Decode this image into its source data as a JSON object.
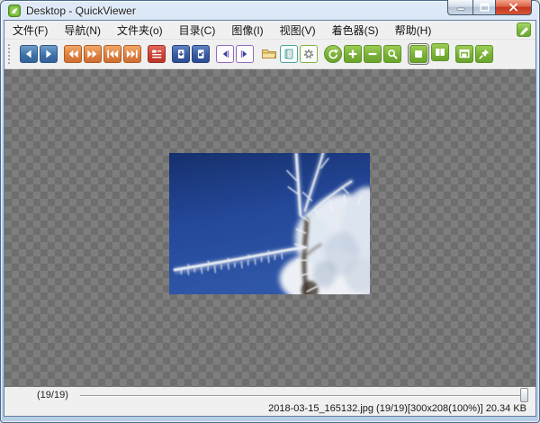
{
  "window": {
    "title": "Desktop - QuickViewer",
    "controls": [
      "minimize-icon",
      "maximize-icon",
      "close-icon"
    ]
  },
  "menu": {
    "items": [
      "文件(F)",
      "导航(N)",
      "文件夹(o)",
      "目录(C)",
      "图像(I)",
      "视图(V)",
      "着色器(S)",
      "帮助(H)"
    ],
    "edit_button_icon": "pencil-icon"
  },
  "toolbar": {
    "buttons": [
      "prev-image",
      "next-image",
      "fast-backward",
      "fast-forward",
      "first-image",
      "last-image",
      "file-list",
      "next-volume",
      "prev-volume",
      "prev-folder",
      "next-folder",
      "open-folder",
      "catalog",
      "settings",
      "reload",
      "zoom-in",
      "zoom-out",
      "zoom-search",
      "fit-window",
      "spread-view",
      "fullscreen",
      "stay-on-top"
    ],
    "selected_button": "fit-window"
  },
  "statusbar": {
    "page_indicator": "(19/19)",
    "status_text": "2018-03-15_165132.jpg (19/19)[300x208(100%)] 20.34 KB"
  },
  "colors": {
    "accent_green": "#7cb93d",
    "accent_blue": "#3d6fa8",
    "accent_orange": "#dd7e3e",
    "accent_red": "#c94033",
    "accent_purple": "#936bbe",
    "titlebar": "#bed4ec",
    "checker_light": "#7e7e7e",
    "checker_dark": "#6e6e6e",
    "toolbar_bg": "#f0f0f0"
  }
}
